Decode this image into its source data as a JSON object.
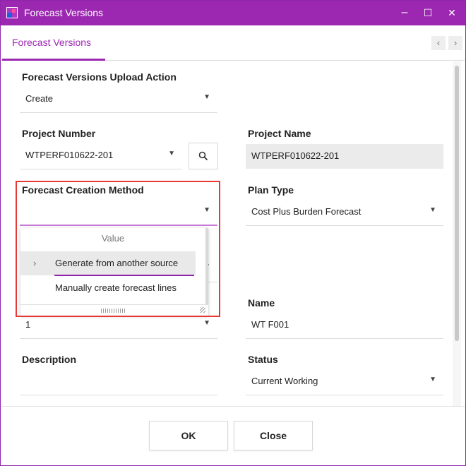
{
  "window": {
    "title": "Forecast Versions",
    "controls": {
      "minimize": "–",
      "maximize": "☐",
      "close": "✕"
    }
  },
  "tabs": {
    "active_label": "Forecast Versions",
    "prev": "‹",
    "next": "›"
  },
  "form": {
    "upload_action": {
      "label": "Forecast Versions Upload Action",
      "value": "Create"
    },
    "project_number": {
      "label": "Project Number",
      "value": "WTPERF010622-201"
    },
    "project_name": {
      "label": "Project Name",
      "value": "WTPERF010622-201"
    },
    "creation_method": {
      "label": "Forecast Creation Method",
      "value": ""
    },
    "plan_type": {
      "label": "Plan Type",
      "value": "Cost Plus Burden Forecast"
    },
    "version_number": {
      "value": "1"
    },
    "name": {
      "label": "Name",
      "value": "WT F001"
    },
    "description": {
      "label": "Description",
      "value": ""
    },
    "status": {
      "label": "Status",
      "value": "Current Working"
    }
  },
  "dropdown": {
    "header": "Value",
    "options": [
      {
        "label": "Generate from another source",
        "selected": true
      },
      {
        "label": "Manually create forecast lines",
        "selected": false
      }
    ]
  },
  "footer": {
    "ok_label": "OK",
    "close_label": "Close"
  },
  "colors": {
    "accent": "#9c27b0",
    "highlight_border": "#e53935"
  }
}
